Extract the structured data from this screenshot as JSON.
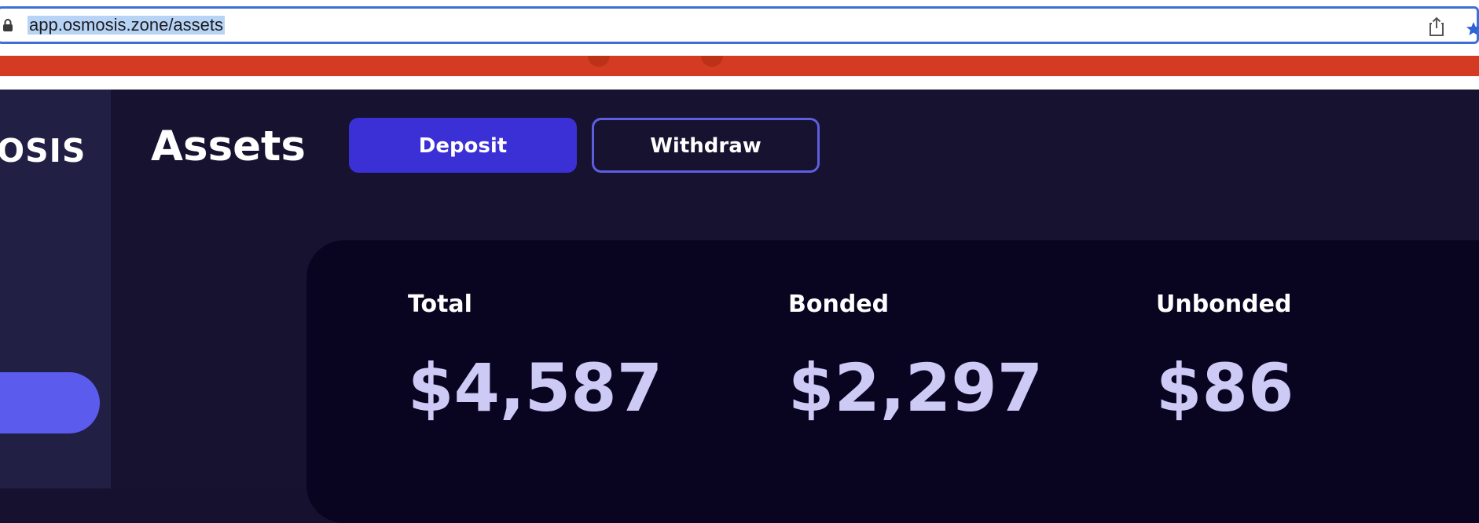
{
  "browser": {
    "url": "app.osmosis.zone/assets",
    "icons": [
      "lock-icon",
      "share-icon",
      "bookmark-icon"
    ]
  },
  "sidebar": {
    "logo_text": "IOSIS"
  },
  "header": {
    "title": "Assets",
    "deposit_label": "Deposit",
    "withdraw_label": "Withdraw"
  },
  "summary": {
    "total": {
      "label": "Total",
      "value": "$4,587"
    },
    "bonded": {
      "label": "Bonded",
      "value": "$2,297"
    },
    "unbonded": {
      "label": "Unbonded",
      "value": "$86"
    }
  },
  "colors": {
    "background": "#16122f",
    "sidebar": "#221f45",
    "card": "#090521",
    "deposit_button": "#3b2fd6",
    "withdraw_border": "#5f5ee0",
    "value_text": "#cdcaf5",
    "banner": "#d33b22",
    "address_focus": "#3d6fd6"
  }
}
